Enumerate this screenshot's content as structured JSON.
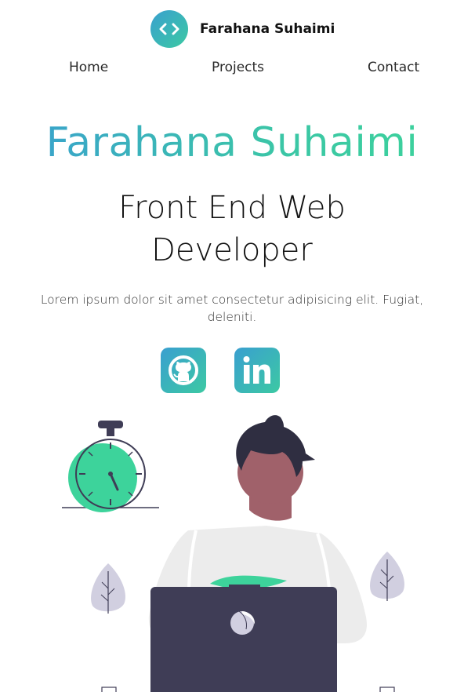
{
  "brand": {
    "name": "Farahana Suhaimi",
    "logo_icon": "code-brackets-icon"
  },
  "nav": {
    "items": [
      {
        "label": "Home"
      },
      {
        "label": "Projects"
      },
      {
        "label": "Contact"
      }
    ]
  },
  "hero": {
    "name": "Farahana Suhaimi",
    "role": "Front End Web Developer",
    "description": "Lorem ipsum dolor sit amet consectetur adipisicing elit. Fugiat, deleniti."
  },
  "social": {
    "items": [
      {
        "icon": "github-icon"
      },
      {
        "icon": "linkedin-icon"
      }
    ]
  },
  "colors": {
    "gradient_start": "#3a9fd0",
    "gradient_end": "#3cc9a3",
    "illustration_accent": "#3dd39b",
    "illustration_dark": "#3f3d56",
    "skin": "#a0616a",
    "hair": "#2f2e41",
    "plant": "#d1cfe0"
  }
}
